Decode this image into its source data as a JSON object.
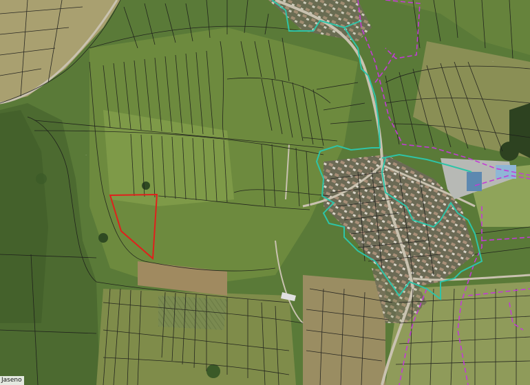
{
  "map": {
    "style": "satellite imagery with cadastral parcel overlay",
    "place_label": "Jaseno",
    "colors": {
      "parcel_lines": "#1a1a1a",
      "village_boundary": "#2ec4a8",
      "dashed_boundary": "#c23bd6",
      "selected_parcel": "#e0201c",
      "field_green": "#5c7a3a",
      "forest_dark": "#2f4a22",
      "road": "#c9c2b0"
    },
    "layers": [
      {
        "name": "cadastral-parcels",
        "visible": true
      },
      {
        "name": "built-up-area-boundary",
        "visible": true
      },
      {
        "name": "dashed-boundary",
        "visible": true
      },
      {
        "name": "selected-parcel",
        "visible": true
      }
    ]
  }
}
